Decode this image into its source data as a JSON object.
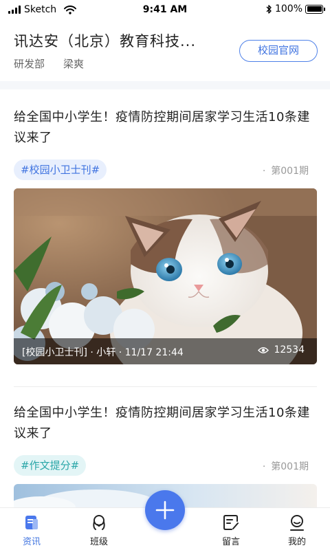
{
  "status_bar": {
    "carrier": "Sketch",
    "time": "9:41 AM",
    "battery": "100%",
    "battery_level": 1.0
  },
  "header": {
    "school_name": "讯达安（北京）教育科技...",
    "department": "研发部",
    "user_name": "梁爽",
    "official_site_button": "校园官网"
  },
  "articles": [
    {
      "title": "给全国中小学生！疫情防控期间居家学习生活10条建议来了",
      "tag": "#校园小卫士刊#",
      "issue": "第001期",
      "issue_dot": "·",
      "caption": "[校园小卫士刊] · 小轩 · 11/17 21:44",
      "views": "12534"
    },
    {
      "title": "给全国中小学生！疫情防控期间居家学习生活10条建议来了",
      "tag": "#作文提分#",
      "issue": "第001期",
      "issue_dot": "·"
    }
  ],
  "tabbar": {
    "items": [
      {
        "label": "资讯",
        "icon": "news-icon",
        "active": true
      },
      {
        "label": "班级",
        "icon": "class-icon",
        "active": false
      },
      {
        "label": "留言",
        "icon": "message-icon",
        "active": false
      },
      {
        "label": "我的",
        "icon": "profile-icon",
        "active": false
      }
    ],
    "fab_icon": "plus-icon"
  },
  "colors": {
    "accent": "#3f73e0",
    "fab": "#4a78ec",
    "teal": "#2aa6a8"
  }
}
